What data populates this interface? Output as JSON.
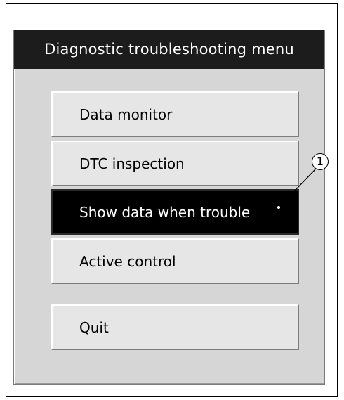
{
  "window": {
    "title": "Diagnostic troubleshooting menu"
  },
  "menu": {
    "items": [
      {
        "label": "Data monitor",
        "selected": false
      },
      {
        "label": "DTC inspection",
        "selected": false
      },
      {
        "label": "Show data when trouble",
        "selected": true
      },
      {
        "label": "Active control",
        "selected": false
      }
    ],
    "quit_label": "Quit"
  },
  "callout": {
    "label": "1"
  },
  "colors": {
    "titlebar_bg": "#1c1c1c",
    "window_bg": "#d6d6d6",
    "button_bg": "#e6e6e6",
    "selected_bg": "#000000",
    "selected_text": "#ffffff"
  }
}
